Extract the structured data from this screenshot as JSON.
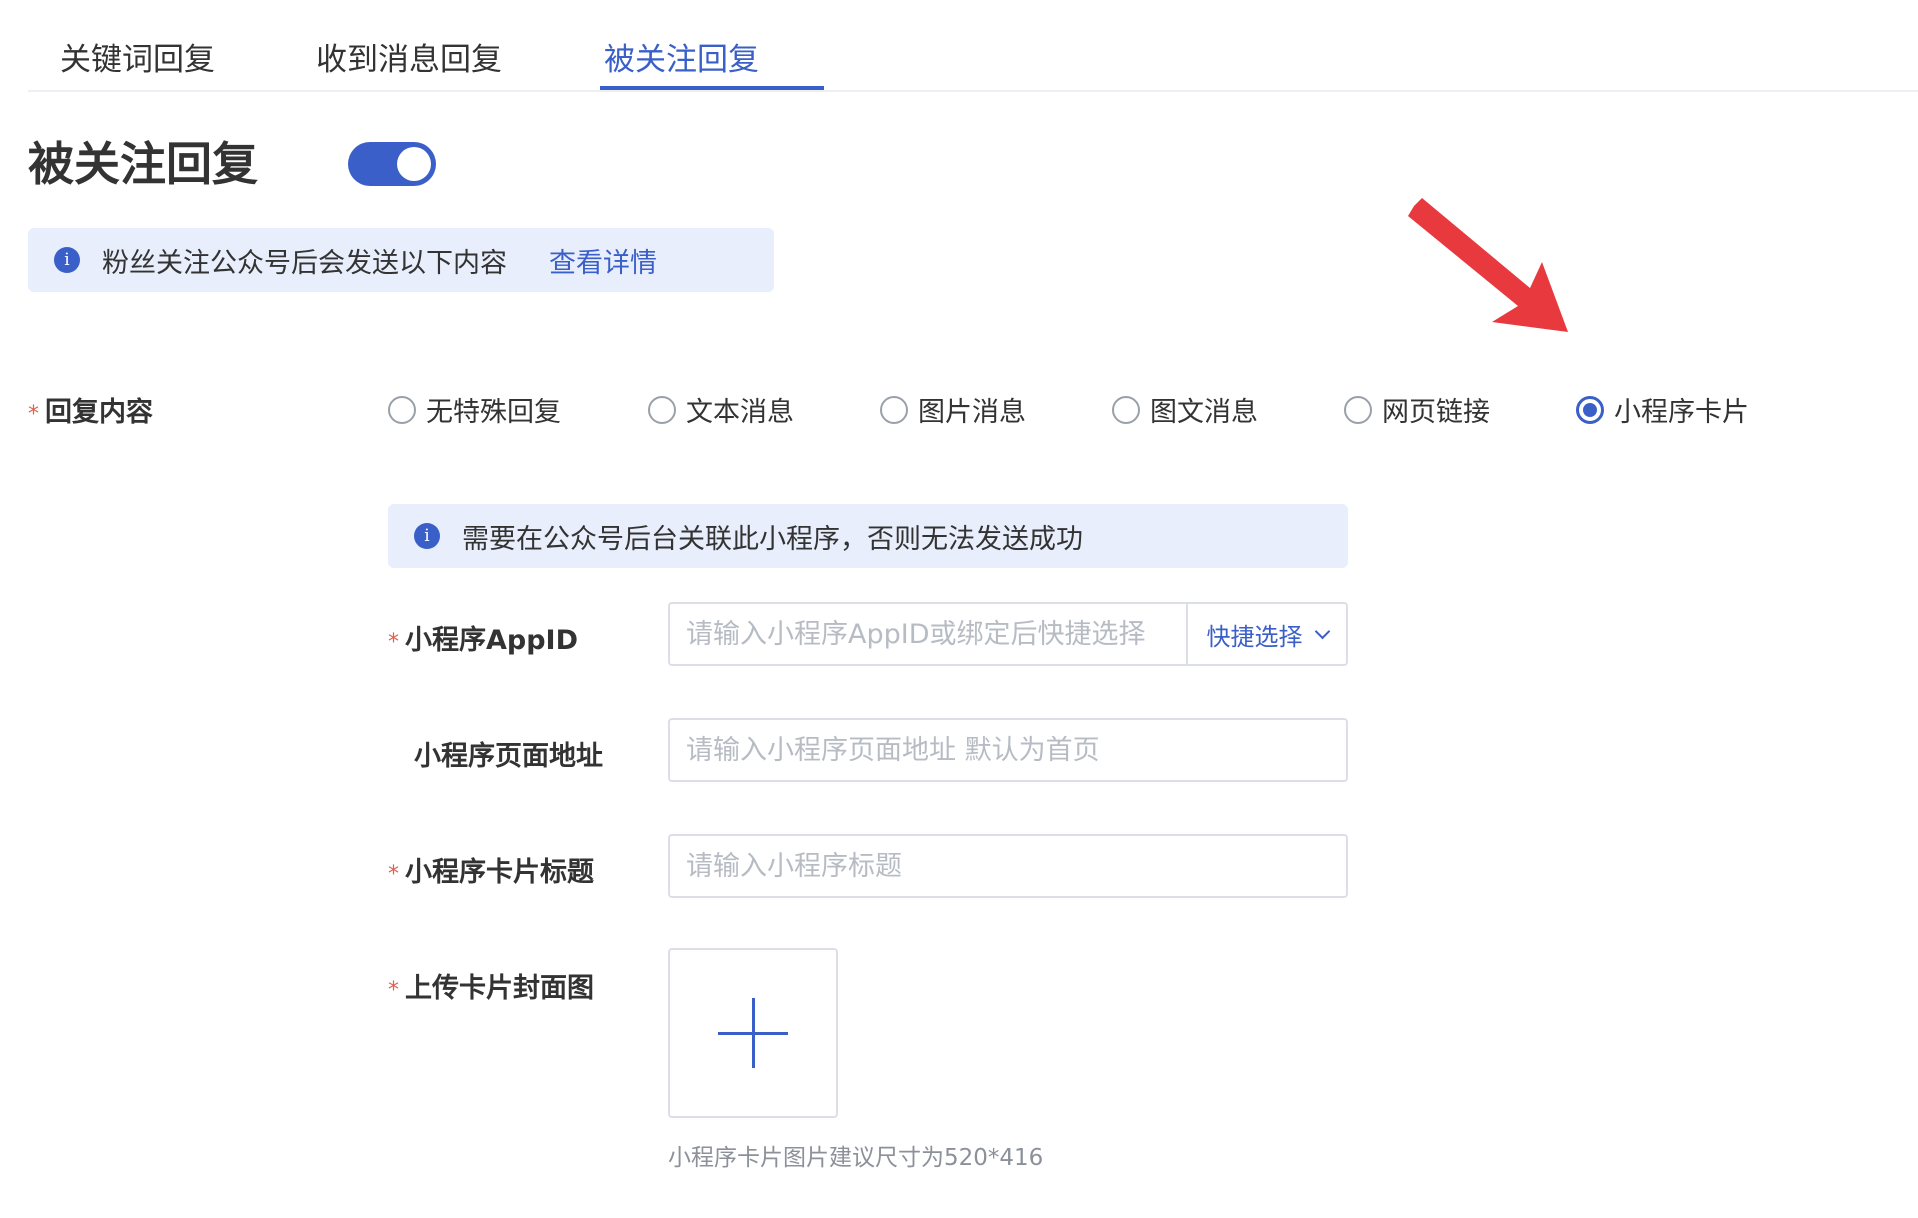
{
  "tabs": [
    {
      "label": "关键词回复"
    },
    {
      "label": "收到消息回复"
    },
    {
      "label": "被关注回复"
    }
  ],
  "page_title": "被关注回复",
  "toggle": {
    "on": true
  },
  "notice_top": {
    "text": "粉丝关注公众号后会发送以下内容",
    "link": "查看详情"
  },
  "reply_content": {
    "label": "回复内容",
    "options": [
      {
        "label": "无特殊回复"
      },
      {
        "label": "文本消息"
      },
      {
        "label": "图片消息"
      },
      {
        "label": "图文消息"
      },
      {
        "label": "网页链接"
      },
      {
        "label": "小程序卡片"
      }
    ],
    "selected": "小程序卡片"
  },
  "notice_mini": {
    "text": "需要在公众号后台关联此小程序，否则无法发送成功"
  },
  "fields": {
    "appid": {
      "label": "小程序AppID",
      "placeholder": "请输入小程序AppID或绑定后快捷选择",
      "value": "",
      "quick_select": "快捷选择"
    },
    "page_path": {
      "label": "小程序页面地址",
      "placeholder": "请输入小程序页面地址 默认为首页",
      "value": ""
    },
    "card_title": {
      "label": "小程序卡片标题",
      "placeholder": "请输入小程序标题",
      "value": ""
    },
    "cover": {
      "label": "上传卡片封面图",
      "hint": "小程序卡片图片建议尺寸为520*416"
    }
  },
  "required_mark": "*",
  "colors": {
    "accent": "#3a5fc8",
    "notice_bg": "#e8eefb",
    "required": "#e0604f",
    "annotation_arrow": "#e8393f"
  },
  "icons": {
    "info": "info-icon",
    "plus": "plus-icon",
    "chevron": "chevron-down-icon",
    "annotation": "red-arrow-icon"
  }
}
